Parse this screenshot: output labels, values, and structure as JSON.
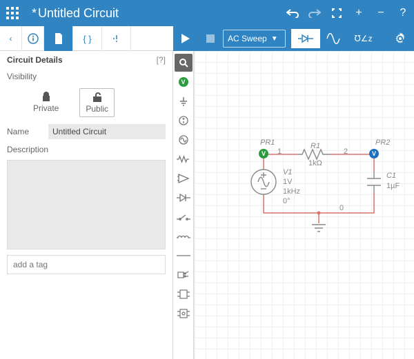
{
  "app": {
    "title": "Untitled Circuit",
    "dirty_mark": "*",
    "actions": {
      "undo": "undo",
      "redo": "redo",
      "fullscreen": "fullscreen",
      "plus": "+",
      "minus": "−",
      "help": "?"
    }
  },
  "tabs": {
    "back": "‹",
    "info": "info",
    "document": "document",
    "code": "{ }",
    "errors": "•!"
  },
  "simbar": {
    "run": "run",
    "stop": "stop",
    "mode": "AC Sweep",
    "modes": {
      "diode": "diode",
      "sine": "sine",
      "wz": "℧∠z"
    },
    "settings": "settings"
  },
  "details": {
    "header": "Circuit Details",
    "help": "[?]",
    "visibility_label": "Visibility",
    "visibility": {
      "private": "Private",
      "public": "Public",
      "selected": "Public"
    },
    "name_label": "Name",
    "name_value": "Untitled Circuit",
    "description_label": "Description",
    "description_value": "",
    "tag_placeholder": "add a tag"
  },
  "palette": {
    "search": "search",
    "probe": "V",
    "row_labels": [
      "ground",
      "dc-source",
      "ac-source",
      "resistor",
      "opamp",
      "diode",
      "switch",
      "inductor",
      "wire",
      "capacitor-ic",
      "digital-ic",
      "more"
    ]
  },
  "circuit": {
    "probes": {
      "PR1": "PR1",
      "PR2": "PR2"
    },
    "R1": {
      "name": "R1",
      "value": "1kΩ"
    },
    "V1": {
      "name": "V1",
      "amp": "1V",
      "freq": "1kHz",
      "phase": "0°"
    },
    "C1": {
      "name": "C1",
      "value": "1µF"
    },
    "nodes": {
      "n1": "1",
      "n2": "2",
      "n0": "0"
    },
    "colors": {
      "wire": "#d9746c",
      "comp": "#888"
    }
  }
}
